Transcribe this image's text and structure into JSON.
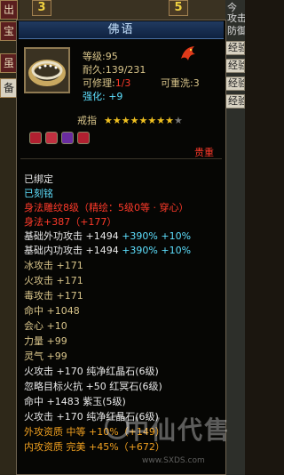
{
  "background": {
    "top_icons": [
      "3",
      "5"
    ],
    "left_icons": [
      "出",
      "宝",
      "虽",
      "备"
    ],
    "right_texts": [
      "今",
      "攻击",
      "防御",
      "经验",
      "经验",
      "经验",
      "经验"
    ]
  },
  "tooltip": {
    "title": "佛语",
    "level": "等级:95",
    "durability": "耐久:139/231",
    "repairable_label": "可修理:",
    "repairable_value": "1/3",
    "rewash": "可重洗:3",
    "enhance": "强化: +9",
    "type": "戒指",
    "stars": {
      "filled": 8,
      "total": 9
    },
    "weight_tag": "贵重",
    "status_lines": [
      "已绑定",
      "已刻铭"
    ],
    "engraving": "身法雕纹8级（精绘：5级0等 · 穿心）",
    "engraving_bonus": "身法+387（+177）",
    "attributes": [
      {
        "text": "基础外功攻击 +1494 ",
        "extra": "+390% +10%",
        "color": "white"
      },
      {
        "text": "基础内功攻击 +1494 ",
        "extra": "+390% +10%",
        "color": "white"
      },
      {
        "text": "冰攻击 +171",
        "extra": "",
        "color": "gold"
      },
      {
        "text": "火攻击 +171",
        "extra": "",
        "color": "gold"
      },
      {
        "text": "毒攻击 +171",
        "extra": "",
        "color": "gold"
      },
      {
        "text": "命中 +1048",
        "extra": "",
        "color": "gold"
      },
      {
        "text": "会心 +10",
        "extra": "",
        "color": "gold"
      },
      {
        "text": "力量 +99",
        "extra": "",
        "color": "gold"
      },
      {
        "text": "灵气 +99",
        "extra": "",
        "color": "gold"
      },
      {
        "text": "火攻击 +170 纯净红晶石(6级)",
        "extra": "",
        "color": "white"
      },
      {
        "text": "忽略目标火抗 +50 红冥石(6级)",
        "extra": "",
        "color": "white"
      },
      {
        "text": "命中 +1483 紫玉(5级)",
        "extra": "",
        "color": "white"
      },
      {
        "text": "火攻击 +170 纯净红晶石(6级)",
        "extra": "",
        "color": "white"
      }
    ],
    "aptitudes": [
      {
        "text": "外攻资质  中等 +10%（+149）"
      },
      {
        "text": "内攻资质  完美 +45%（+672）"
      }
    ]
  },
  "watermark": {
    "main": "中仙代售",
    "url": "www.SXDS.com"
  }
}
